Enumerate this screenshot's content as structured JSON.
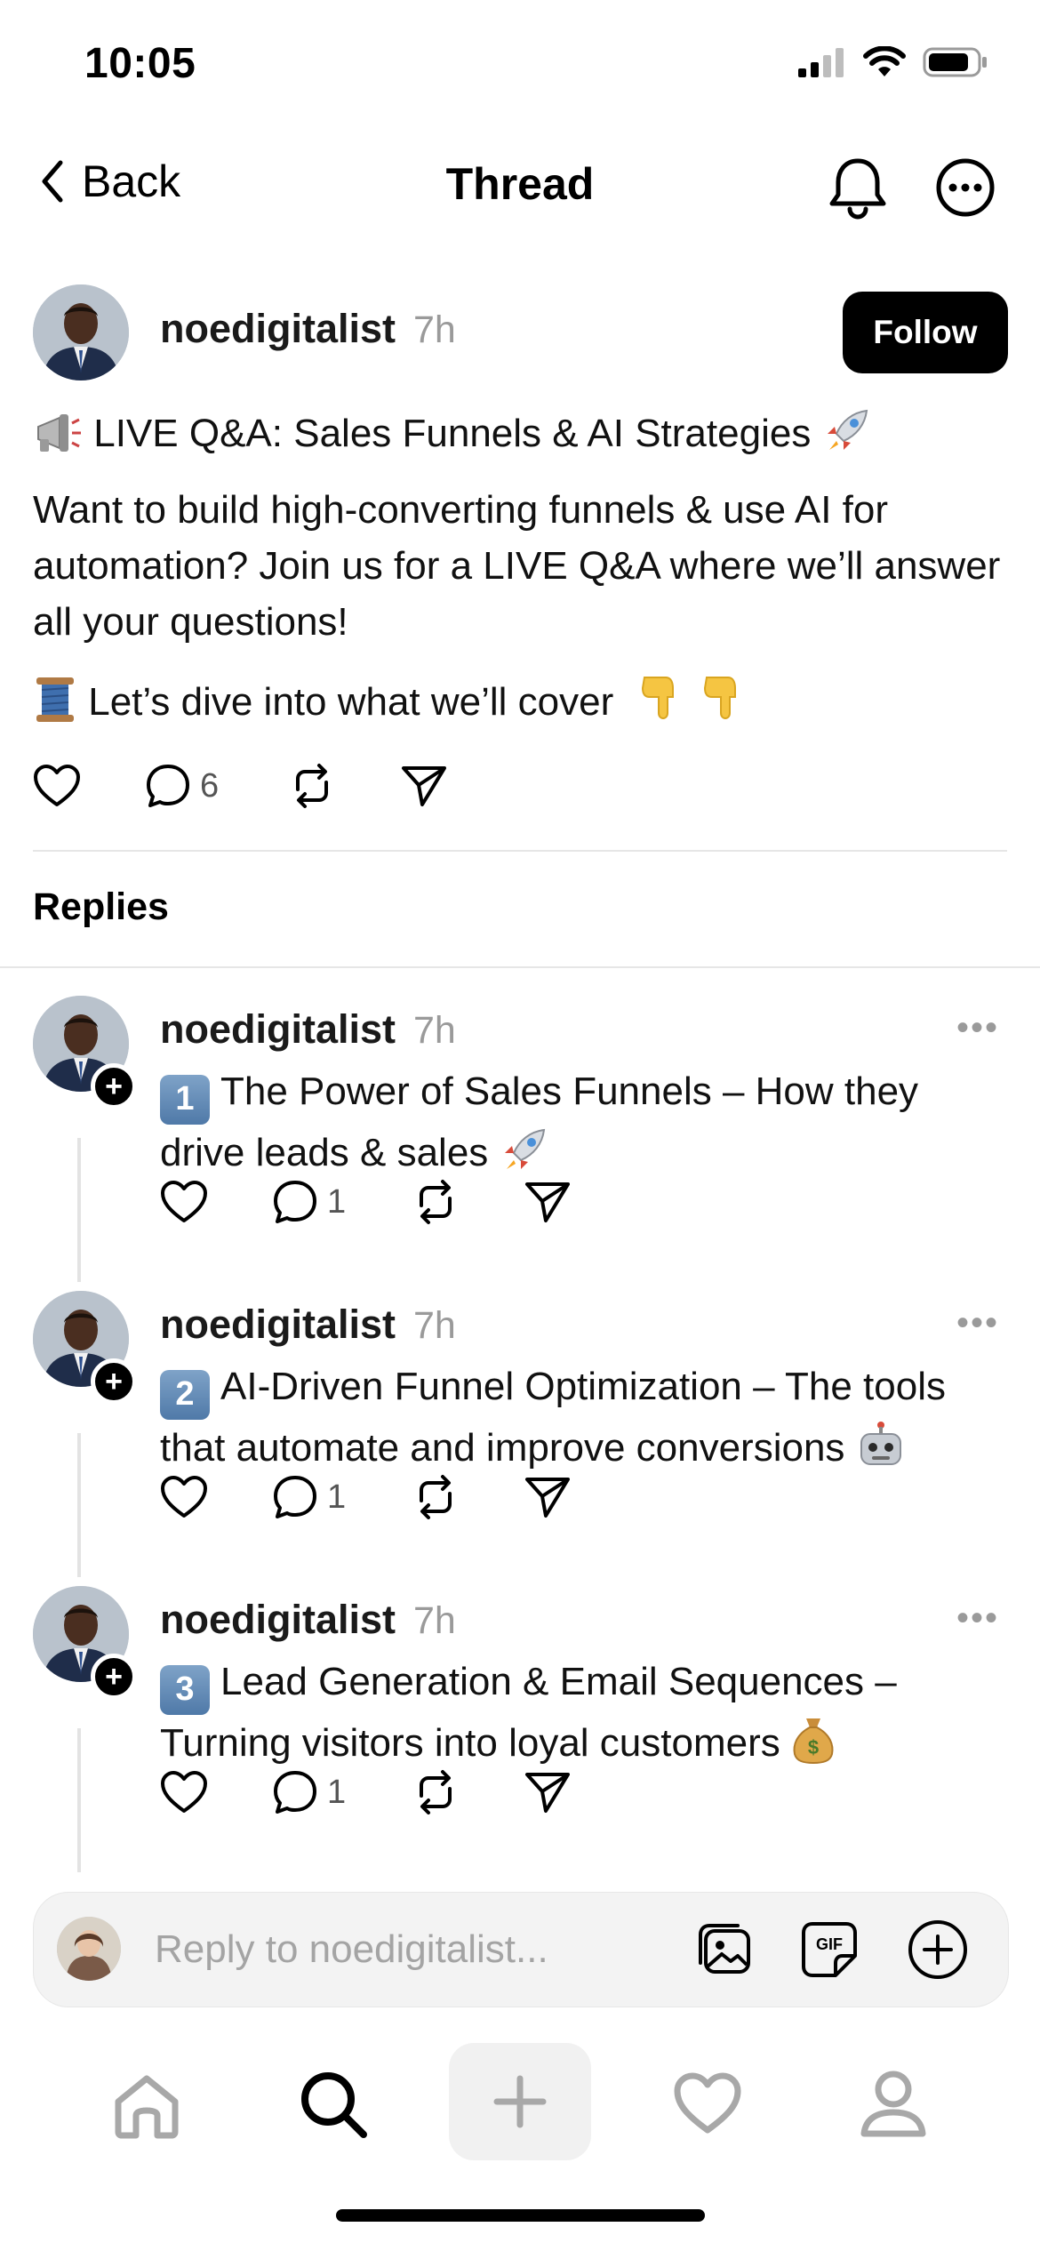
{
  "status_bar": {
    "time": "10:05"
  },
  "nav": {
    "back_label": "Back",
    "title": "Thread"
  },
  "post": {
    "username": "noedigitalist",
    "timestamp": "7h",
    "follow_label": "Follow",
    "headline": "LIVE Q&A: Sales Funnels & AI Strategies",
    "body": "Want to build high-converting funnels & use AI for automation? Join us for a LIVE Q&A where we’ll answer all your questions!",
    "cover_line": "Let’s dive into what we’ll cover",
    "comment_count": "6",
    "emoji_icons": [
      "megaphone-icon",
      "rocket-icon",
      "thread-spool-icon",
      "pointing-down-icon",
      "pointing-down-icon"
    ]
  },
  "replies_heading": "Replies",
  "replies": [
    {
      "username": "noedigitalist",
      "timestamp": "7h",
      "number": "1",
      "line1": "The Power of Sales Funnels – How they",
      "line2": "drive leads & sales",
      "comment_count": "1",
      "end_emoji": "rocket-icon"
    },
    {
      "username": "noedigitalist",
      "timestamp": "7h",
      "number": "2",
      "line1": "AI-Driven Funnel Optimization – The tools",
      "line2": "that automate and improve conversions",
      "comment_count": "1",
      "end_emoji": "robot-icon"
    },
    {
      "username": "noedigitalist",
      "timestamp": "7h",
      "number": "3",
      "line1": "Lead Generation & Email Sequences –",
      "line2": "Turning visitors into loyal customers",
      "comment_count": "1",
      "end_emoji": "money-bag-icon"
    }
  ],
  "composer": {
    "placeholder": "Reply to noedigitalist..."
  },
  "tabbar": {
    "items": [
      "home-icon",
      "search-icon",
      "new-thread-icon",
      "activity-heart-icon",
      "profile-icon"
    ],
    "active": "search-icon"
  },
  "colors": {
    "text": "#000000",
    "muted": "#9a9a9a",
    "divider": "#e6e6e6",
    "button": "#000000"
  }
}
